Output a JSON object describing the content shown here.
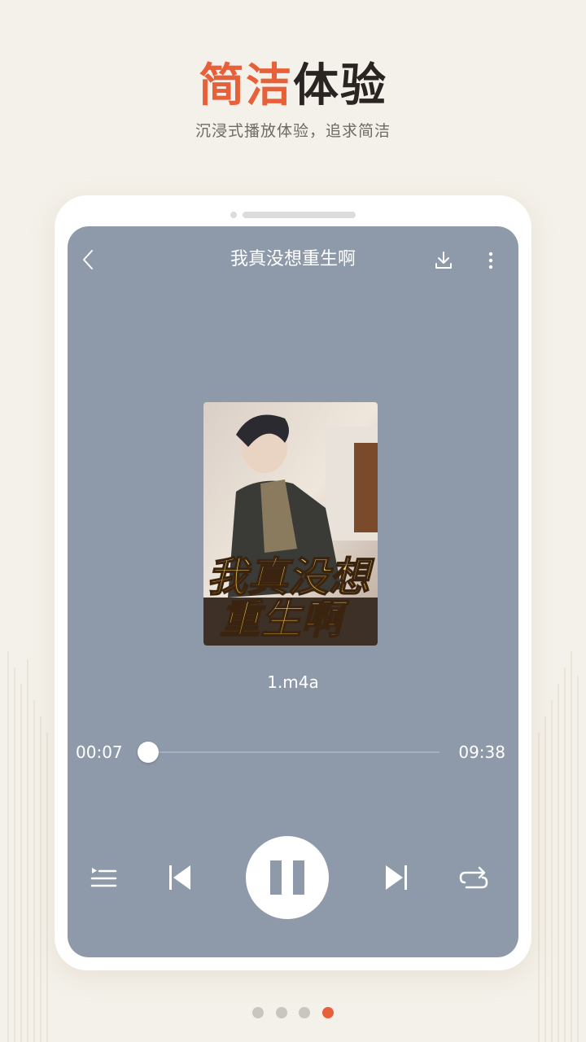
{
  "headline": {
    "accent": "简洁",
    "rest": "体验"
  },
  "subtitle": "沉浸式播放体验，追求简洁",
  "player": {
    "title": "我真没想重生啊",
    "cover_text_line1": "我真没想",
    "cover_text_line2": "重生啊",
    "filename": "1.m4a",
    "time_elapsed": "00:07",
    "time_total": "09:38",
    "progress_fraction": 0.012,
    "is_playing": true
  },
  "icons": {
    "back": "back-chevron-icon",
    "download": "download-icon",
    "more": "more-vertical-icon",
    "playlist": "playlist-icon",
    "prev": "skip-previous-icon",
    "pause": "pause-icon",
    "next": "skip-next-icon",
    "repeat": "repeat-icon"
  },
  "pagination": {
    "count": 4,
    "active_index": 3
  },
  "colors": {
    "accent": "#e8603a",
    "page_background": "#f4f1ea",
    "player_background": "#8e9aaa"
  }
}
